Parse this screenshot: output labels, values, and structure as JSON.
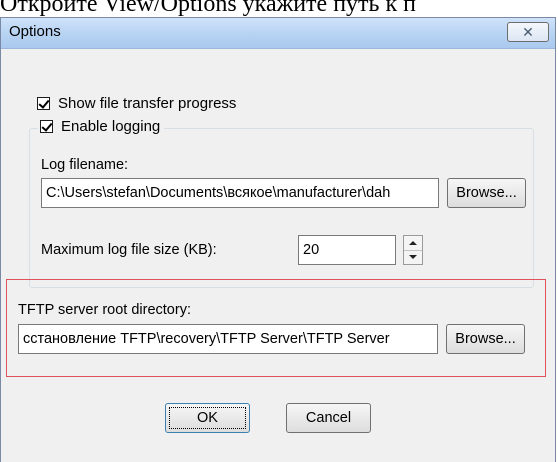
{
  "doc_caption": "Откройте View/Options  укажите путь к п",
  "window": {
    "title": "Options",
    "close_glyph": "✕"
  },
  "options": {
    "show_progress": {
      "label": "Show file transfer progress",
      "checked": true
    },
    "enable_logging": {
      "label": "Enable logging",
      "checked": true
    },
    "log_filename_label": "Log filename:",
    "log_filename_value": "C:\\Users\\stefan\\Documents\\всякое\\manufacturer\\dah",
    "browse_label": "Browse...",
    "max_log_size_label": "Maximum log file size (KB):",
    "max_log_size_value": "20",
    "tftp_root_label": "TFTP server root directory:",
    "tftp_root_value": "сстановление TFTP\\recovery\\TFTP Server\\TFTP Server",
    "tftp_browse_label": "Browse..."
  },
  "footer": {
    "ok_label": "OK",
    "cancel_label": "Cancel"
  },
  "colors": {
    "highlight": "#e2525c",
    "dialog_bg": "#f0f0f0"
  }
}
